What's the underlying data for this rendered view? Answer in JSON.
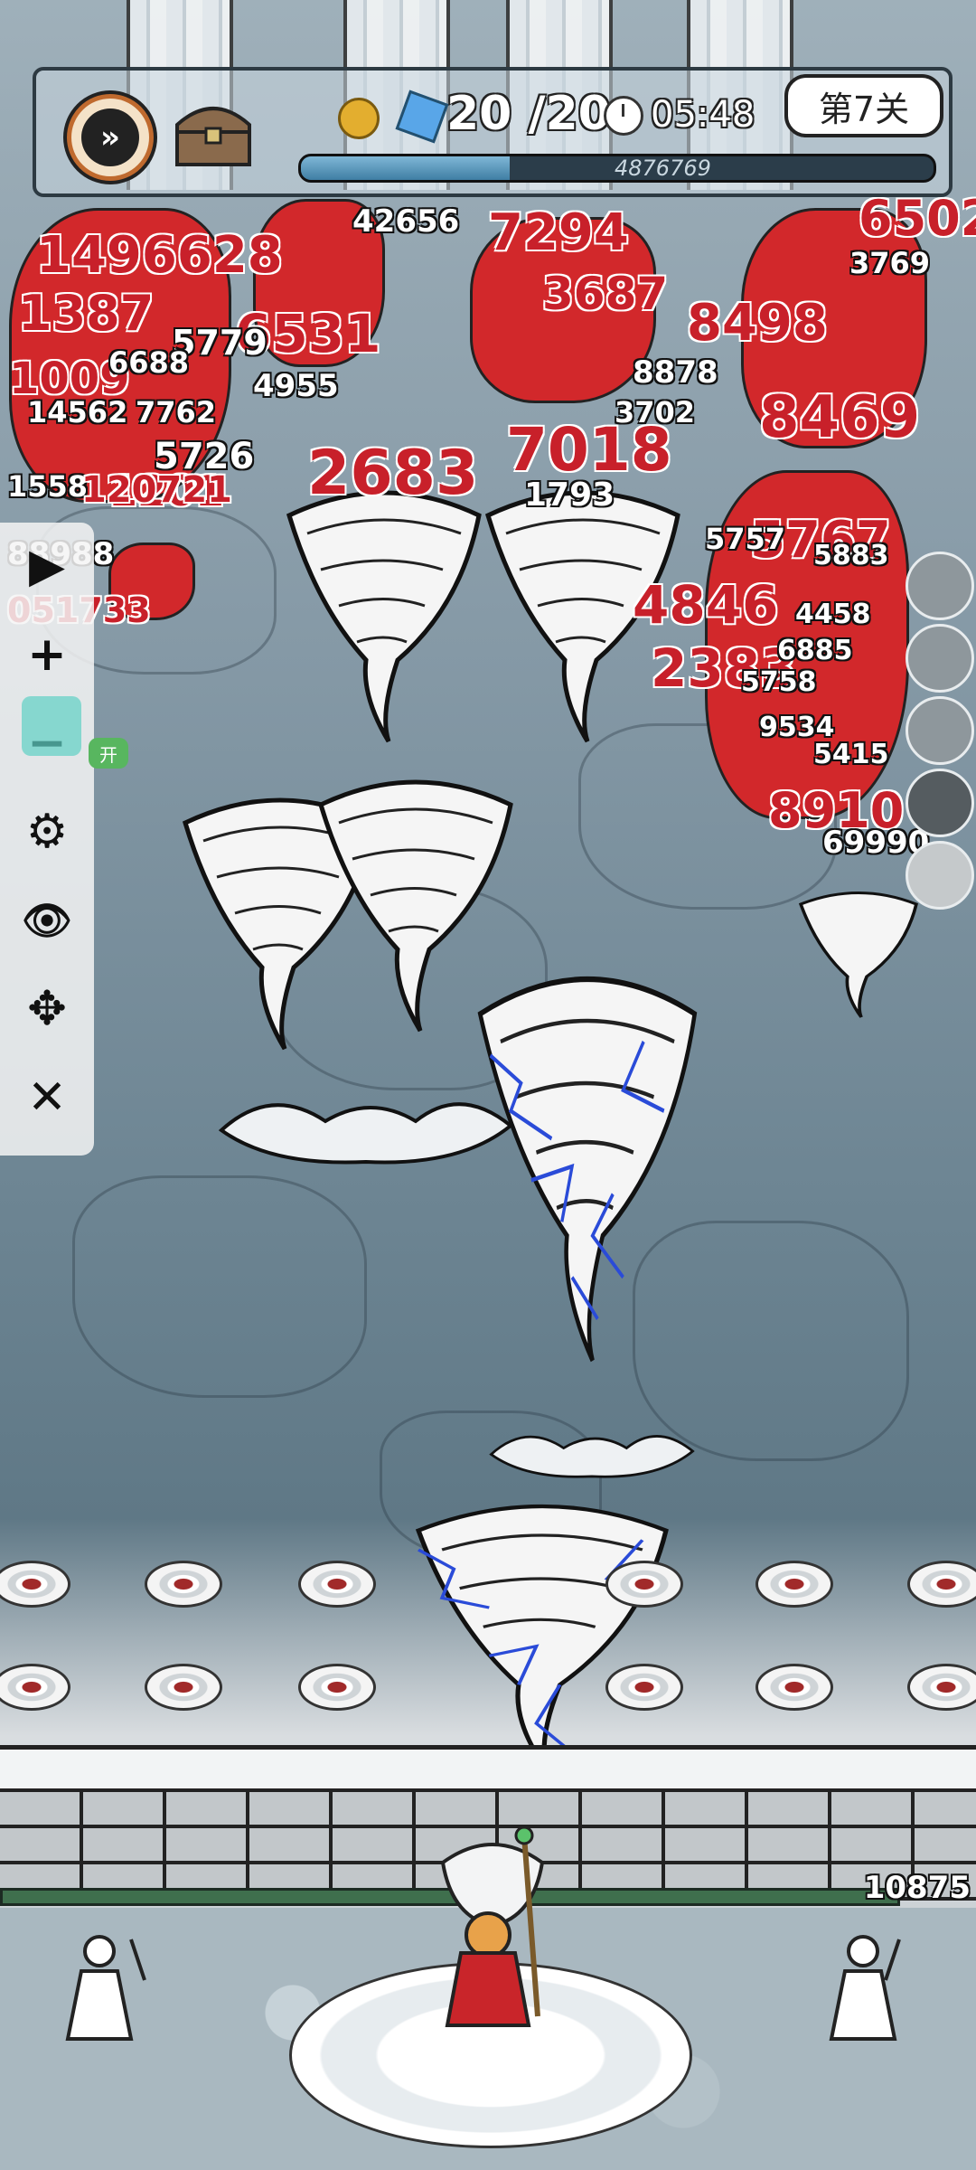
{
  "hud": {
    "speed_button_icon": "fast-forward-icon",
    "chest_icon": "treasure-chest-icon",
    "currency_icons": [
      "coin-icon",
      "gem-icon"
    ],
    "energy": "20 /20",
    "timer_icon": "clock-icon",
    "timer": "05:48",
    "level": "第7关",
    "wave_progress": 0.33,
    "wave_progress_text": "4876769"
  },
  "toolbar": {
    "buttons": [
      {
        "icon": "play-icon",
        "label": "▶"
      },
      {
        "icon": "plus-icon",
        "label": "+"
      },
      {
        "icon": "minus-icon",
        "label": "−"
      },
      {
        "icon": "gear-icon",
        "label": "⚙"
      },
      {
        "icon": "eye-icon",
        "label": "👁"
      },
      {
        "icon": "move-icon",
        "label": "✥"
      },
      {
        "icon": "close-icon",
        "label": "✕"
      }
    ],
    "toggle_label": "开"
  },
  "wall": {
    "hp": "10875"
  },
  "damage_numbers": {
    "red": [
      "1496628",
      "6502",
      "1387",
      "1009",
      "2683",
      "7018",
      "8469",
      "2383",
      "8910",
      "6531",
      "7294",
      "4846",
      "5767",
      "8498",
      "1201",
      "3687"
    ],
    "white": [
      "42656",
      "3769",
      "5779",
      "6688",
      "14562",
      "7762",
      "1558",
      "120721",
      "5726",
      "4955",
      "3702",
      "88988",
      "051733",
      "1793",
      "69990",
      "5757",
      "5883",
      "4458",
      "6885",
      "5758",
      "9534",
      "5415",
      "8878"
    ]
  },
  "skills": [
    "tornado-skill-icon",
    "ice-skill-icon",
    "whirlwind-skill-icon",
    "stone-skill-icon",
    "empty-skill-slot"
  ]
}
